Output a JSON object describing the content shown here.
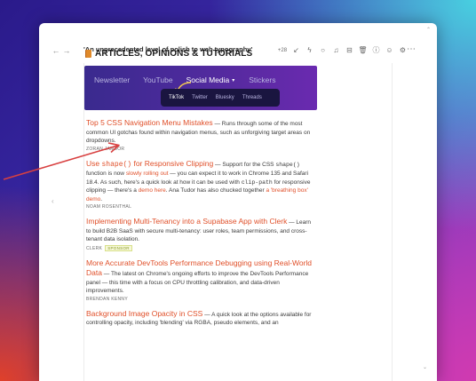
{
  "window": {
    "title": "'An unprecedented level of polish to web typography'",
    "nav": {
      "back": "←",
      "forward": "→"
    },
    "toolbar_count": "+28",
    "more": "⋯"
  },
  "section": {
    "title": "ARTICLES, OPINIONS & TUTORIALS"
  },
  "banner": {
    "tabs": [
      "Newsletter",
      "YouTube",
      "Social Media",
      "Stickers"
    ],
    "active_tab": "Social Media",
    "caret": "▾",
    "sub_tabs": [
      "TikTok",
      "Twitter",
      "Bluesky",
      "Threads"
    ],
    "active_sub": "TikTok"
  },
  "articles": [
    {
      "title": "Top 5 CSS Navigation Menu Mistakes",
      "desc": " — Runs through some of the most common UI gotchas found within navigation menus, such as unforgiving target areas on dropdowns.",
      "author": "ZORAN JAMBOR"
    },
    {
      "title_a": "Use ",
      "title_code": "shape()",
      "title_b": " for Responsive Clipping",
      "desc_a": " — Support for the CSS ",
      "desc_code": "shape()",
      "desc_b": " function is now ",
      "desc_link1": "slowly rolling out",
      "desc_c": " — you can expect it to work in Chrome 135 and Safari 18.4. As such, here's a quick look at how it can be used with ",
      "desc_code2": "clip-path",
      "desc_d": " for responsive clipping — there's a ",
      "desc_link2": "demo here",
      "desc_e": ". Ana Tudor has also chucked together ",
      "desc_link3": "a 'breathing box' demo",
      "desc_f": ".",
      "author": "NOAM ROSENTHAL"
    },
    {
      "title": "Implementing Multi-Tenancy into a Supabase App with Clerk",
      "desc": " — Learn to build B2B SaaS with secure multi-tenancy: user roles, team permissions, and cross-tenant data isolation.",
      "author": "CLERK",
      "badge": "SPONSOR"
    },
    {
      "title": "More Accurate DevTools Performance Debugging using Real-World Data",
      "desc": " — The latest on Chrome's ongoing efforts to improve the DevTools Performance panel — this time with a focus on CPU throttling calibration, and data-driven improvements.",
      "author": "BRENDAN KENNY"
    },
    {
      "title": "Background Image Opacity in CSS",
      "desc": " — A quick look at the options available for controlling opacity, including 'blending' via RGBA, pseudo elements, and an"
    }
  ],
  "colors": {
    "accent": "#e0502a",
    "banner_start": "#3a2a8e",
    "banner_end": "#6a2ab0",
    "annotation_arrow": "#d84040"
  }
}
